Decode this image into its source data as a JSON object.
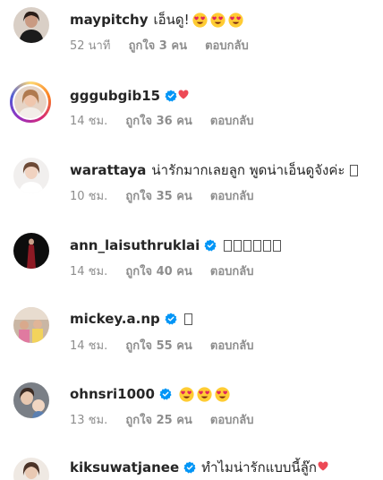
{
  "comments": [
    {
      "username": "maypitchy",
      "verified": false,
      "text": "เอ็นดู!",
      "emoji": [
        "heart-eyes-emoji",
        "heart-eyes-emoji",
        "heart-eyes-emoji"
      ],
      "time": "52 นาที",
      "likes": "ถูกใจ 3 คน",
      "reply": "ตอบกลับ"
    },
    {
      "username": "gggubgib15",
      "verified": true,
      "text": "",
      "heart": true,
      "time": "14 ชม.",
      "likes": "ถูกใจ 36 คน",
      "reply": "ตอบกลับ"
    },
    {
      "username": "warattaya",
      "verified": false,
      "text": "น่ารักมากเลยลูก พูดน่าเอ็นดูจังค่ะ",
      "boxes": 1,
      "time": "10 ชม.",
      "likes": "ถูกใจ 35 คน",
      "reply": "ตอบกลับ"
    },
    {
      "username": "ann_laisuthruklai",
      "verified": true,
      "text": "",
      "boxes": 6,
      "time": "14 ชม.",
      "likes": "ถูกใจ 40 คน",
      "reply": "ตอบกลับ"
    },
    {
      "username": "mickey.a.np",
      "verified": true,
      "text": "",
      "boxes": 1,
      "time": "14 ชม.",
      "likes": "ถูกใจ 55 คน",
      "reply": "ตอบกลับ"
    },
    {
      "username": "ohnsri1000",
      "verified": true,
      "text": "",
      "emoji": [
        "heart-eyes-emoji",
        "heart-eyes-emoji",
        "heart-eyes-emoji"
      ],
      "time": "13 ชม.",
      "likes": "ถูกใจ 25 คน",
      "reply": "ตอบกลับ"
    },
    {
      "username": "kiksuwatjanee",
      "verified": true,
      "text": "ทำไมน่ารักแบบนี้ลู๊ก",
      "heart": true
    }
  ],
  "colors": {
    "text": "#262626",
    "meta": "#8e8e8e",
    "verified": "#0095f6",
    "heart": "#ed4956"
  }
}
